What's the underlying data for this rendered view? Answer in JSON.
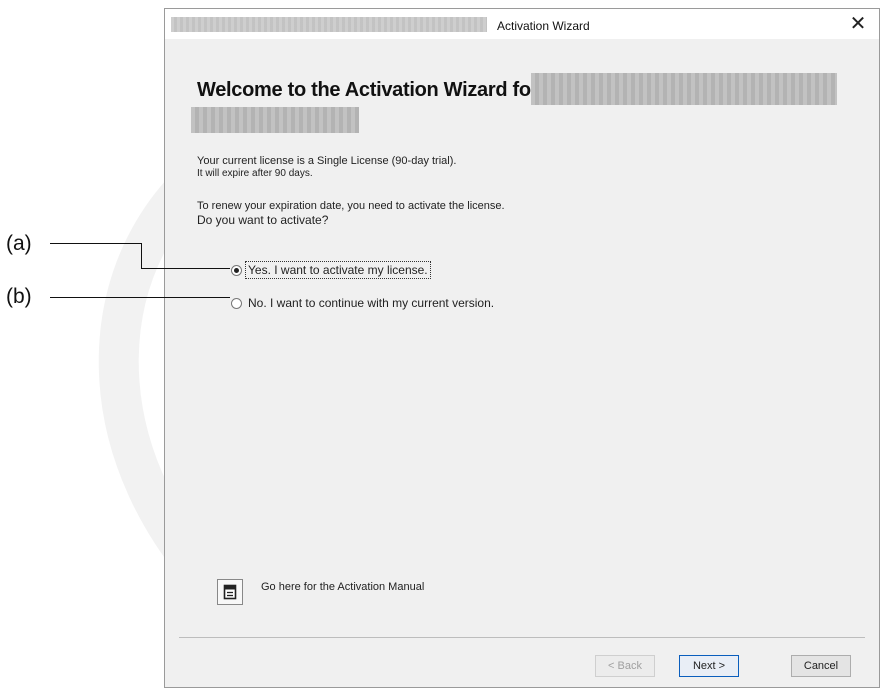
{
  "callouts": {
    "a": "(a)",
    "b": "(b)"
  },
  "window": {
    "title": "Activation Wizard",
    "close_glyph": "✕"
  },
  "content": {
    "heading": "Welcome to the Activation Wizard for",
    "license_line1": "Your current license is a Single License (90-day trial).",
    "license_line2": "It will expire after 90 days.",
    "renew_line1": "To renew your expiration date, you need to activate the license.",
    "renew_line2": "Do you want to activate?"
  },
  "options": [
    {
      "label": "Yes. I want to activate my license.",
      "selected": true
    },
    {
      "label": "No. I want to continue with my current version.",
      "selected": false
    }
  ],
  "manual": {
    "icon": "document-icon",
    "link_text": "Go here for the Activation Manual"
  },
  "buttons": {
    "back": "< Back",
    "next": "Next >",
    "cancel": "Cancel"
  },
  "colors": {
    "focus_border": "#0a5ebd",
    "window_bg": "#f0f0f0"
  }
}
